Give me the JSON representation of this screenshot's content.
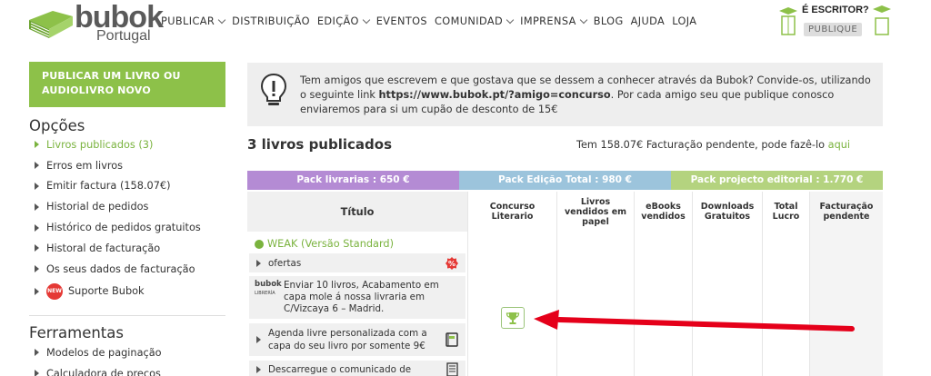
{
  "header": {
    "logo_word": "bubok",
    "logo_sub": "Portugal",
    "nav": [
      {
        "label": "PUBLICAR",
        "dropdown": true
      },
      {
        "label": "DISTRIBUIÇÃO",
        "dropdown": false
      },
      {
        "label": "EDIÇÃO",
        "dropdown": true
      },
      {
        "label": "EVENTOS",
        "dropdown": false
      },
      {
        "label": "COMUNIDAD",
        "dropdown": true
      },
      {
        "label": "IMPRENSA",
        "dropdown": true
      },
      {
        "label": "BLOG",
        "dropdown": false
      },
      {
        "label": "AJUDA",
        "dropdown": false
      },
      {
        "label": "LOJA",
        "dropdown": false
      }
    ],
    "escritor_title": "É ESCRITOR?",
    "escritor_button": "PUBLIQUE"
  },
  "sidebar": {
    "publish_button": "PUBLICAR UM LIVRO OU AUDIOLIVRO NOVO",
    "options_title": "Opções",
    "options": [
      "Livros publicados (3)",
      "Erros em livros",
      "Emitir factura (158.07€)",
      "Historial de pedidos",
      "Histórico de pedidos gratuitos",
      "Historal de facturação",
      "Os seus dados de facturação",
      "Suporte Bubok"
    ],
    "new_badge": "NEW",
    "tools_title": "Ferramentas",
    "tools": [
      "Modelos de paginação",
      "Calculadora de preços"
    ]
  },
  "info": {
    "text_before": "Tem amigos que escrevem e que gostava que se dessem a conhecer através da Bubok? Convide-os, utilizando o seguinte link ",
    "link": "https://www.bubok.pt/?amigo=concurso",
    "text_after": ". Por cada amigo seu que publique conosco enviaremos para si um cupão de desconto de 15€"
  },
  "books_title": "3 livros publicados",
  "pending": {
    "text": "Tem 158.07€ Facturação pendente, pode fazê-lo ",
    "link": "aqui"
  },
  "packs": [
    "Pack livrarias : 650 €",
    "Pack Edição Total : 980 €",
    "Pack projecto editorial : 1.770 €"
  ],
  "table": {
    "headers": [
      "Título",
      "Concurso Literario",
      "Livros vendidos em papel",
      "eBooks vendidos",
      "Downloads Gratuitos",
      "Total Lucro",
      "Facturação pendente"
    ]
  },
  "book": {
    "title": "WEAK (Versão Standard)",
    "offers_label": "ofertas",
    "bubok_logo": "bubok",
    "bubok_logo_sub": "LIBRERÍA",
    "bubok_text": "Enviar 10 livros, Acabamento em capa mole á nossa livraria em C/Vizcaya 6 – Madrid.",
    "agenda_text": "Agenda livre personalizada com a capa do seu livro por somente 9€",
    "download_text": "Descarregue o comunicado de"
  },
  "colors": {
    "brand_green": "#8dc149",
    "link_green": "#7ab33e",
    "pack_purple": "#b48bd4",
    "pack_blue": "#9cc4dc",
    "pack_green": "#b4d37f",
    "arrow_red": "#e5001a"
  },
  "icons": {
    "bulb": "lightbulb-icon",
    "trophy": "trophy-icon",
    "percent": "percent-badge-icon",
    "book": "book-icon",
    "document": "document-icon"
  }
}
